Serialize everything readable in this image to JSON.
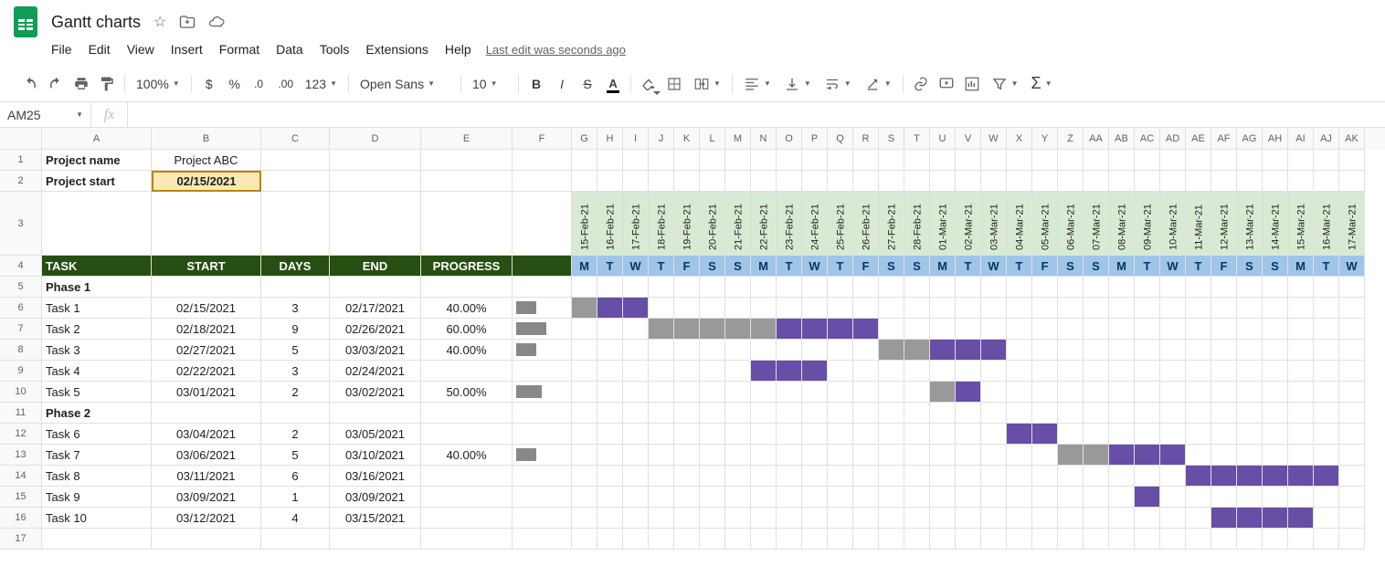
{
  "doc_title": "Gantt charts",
  "menu": {
    "file": "File",
    "edit": "Edit",
    "view": "View",
    "insert": "Insert",
    "format": "Format",
    "data": "Data",
    "tools": "Tools",
    "extensions": "Extensions",
    "help": "Help"
  },
  "last_edit": "Last edit was seconds ago",
  "toolbar": {
    "zoom": "100%",
    "font": "Open Sans",
    "fontsize": "10",
    "numfmt": "123"
  },
  "name_box": "AM25",
  "project_name_label": "Project name",
  "project_name": "Project ABC",
  "project_start_label": "Project start",
  "project_start": "02/15/2021",
  "columns": [
    "A",
    "B",
    "C",
    "D",
    "E",
    "F",
    "G",
    "H",
    "I",
    "J",
    "K",
    "L",
    "M",
    "N",
    "O",
    "P",
    "Q",
    "R",
    "S",
    "T",
    "U",
    "V",
    "W",
    "X",
    "Y",
    "Z",
    "AA",
    "AB",
    "AC",
    "AD",
    "AE",
    "AF",
    "AG",
    "AH",
    "AI",
    "AJ",
    "AK"
  ],
  "dates": [
    "15-Feb-21",
    "16-Feb-21",
    "17-Feb-21",
    "18-Feb-21",
    "19-Feb-21",
    "20-Feb-21",
    "21-Feb-21",
    "22-Feb-21",
    "23-Feb-21",
    "24-Feb-21",
    "25-Feb-21",
    "26-Feb-21",
    "27-Feb-21",
    "28-Feb-21",
    "01-Mar-21",
    "02-Mar-21",
    "03-Mar-21",
    "04-Mar-21",
    "05-Mar-21",
    "06-Mar-21",
    "07-Mar-21",
    "08-Mar-21",
    "09-Mar-21",
    "10-Mar-21",
    "11-Mar-21",
    "12-Mar-21",
    "13-Mar-21",
    "14-Mar-21",
    "15-Mar-21",
    "16-Mar-21",
    "17-Mar-21"
  ],
  "days": [
    "M",
    "T",
    "W",
    "T",
    "F",
    "S",
    "S",
    "M",
    "T",
    "W",
    "T",
    "F",
    "S",
    "S",
    "M",
    "T",
    "W",
    "T",
    "F",
    "S",
    "S",
    "M",
    "T",
    "W",
    "T",
    "F",
    "S",
    "S",
    "M",
    "T",
    "W"
  ],
  "hdr": {
    "task": "TASK",
    "start": "START",
    "days": "DAYS",
    "end": "END",
    "progress": "PROGRESS"
  },
  "rows": [
    {
      "n": 5,
      "task": "Phase 1",
      "bold": true
    },
    {
      "n": 6,
      "task": "Task 1",
      "start": "02/15/2021",
      "days": "3",
      "end": "02/17/2021",
      "progress": "40.00%",
      "pwidth": 40,
      "gantt": {
        "from": 0,
        "len": 3,
        "done": 1,
        "color": "#674ea7"
      }
    },
    {
      "n": 7,
      "task": "Task 2",
      "start": "02/18/2021",
      "days": "9",
      "end": "02/26/2021",
      "progress": "60.00%",
      "pwidth": 60,
      "gantt": {
        "from": 3,
        "len": 9,
        "done": 5,
        "color": "#674ea7"
      }
    },
    {
      "n": 8,
      "task": "Task 3",
      "start": "02/27/2021",
      "days": "5",
      "end": "03/03/2021",
      "progress": "40.00%",
      "pwidth": 40,
      "gantt": {
        "from": 12,
        "len": 5,
        "done": 2,
        "color": "#674ea7"
      }
    },
    {
      "n": 9,
      "task": "Task 4",
      "start": "02/22/2021",
      "days": "3",
      "end": "02/24/2021",
      "progress": "",
      "gantt": {
        "from": 7,
        "len": 3,
        "done": 0,
        "color": "#674ea7"
      }
    },
    {
      "n": 10,
      "task": "Task 5",
      "start": "03/01/2021",
      "days": "2",
      "end": "03/02/2021",
      "progress": "50.00%",
      "pwidth": 50,
      "gantt": {
        "from": 14,
        "len": 2,
        "done": 1,
        "color": "#674ea7"
      }
    },
    {
      "n": 11,
      "task": "Phase 2",
      "bold": true
    },
    {
      "n": 12,
      "task": "Task 6",
      "start": "03/04/2021",
      "days": "2",
      "end": "03/05/2021",
      "progress": "",
      "gantt": {
        "from": 17,
        "len": 2,
        "done": 0,
        "color": "#674ea7"
      }
    },
    {
      "n": 13,
      "task": "Task 7",
      "start": "03/06/2021",
      "days": "5",
      "end": "03/10/2021",
      "progress": "40.00%",
      "pwidth": 40,
      "gantt": {
        "from": 19,
        "len": 5,
        "done": 2,
        "color": "#674ea7"
      }
    },
    {
      "n": 14,
      "task": "Task 8",
      "start": "03/11/2021",
      "days": "6",
      "end": "03/16/2021",
      "progress": "",
      "gantt": {
        "from": 24,
        "len": 6,
        "done": 0,
        "color": "#674ea7"
      }
    },
    {
      "n": 15,
      "task": "Task 9",
      "start": "03/09/2021",
      "days": "1",
      "end": "03/09/2021",
      "progress": "",
      "gantt": {
        "from": 22,
        "len": 1,
        "done": 0,
        "color": "#674ea7"
      }
    },
    {
      "n": 16,
      "task": "Task 10",
      "start": "03/12/2021",
      "days": "4",
      "end": "03/15/2021",
      "progress": "",
      "gantt": {
        "from": 25,
        "len": 4,
        "done": 0,
        "color": "#674ea7"
      }
    },
    {
      "n": 17,
      "task": ""
    }
  ]
}
